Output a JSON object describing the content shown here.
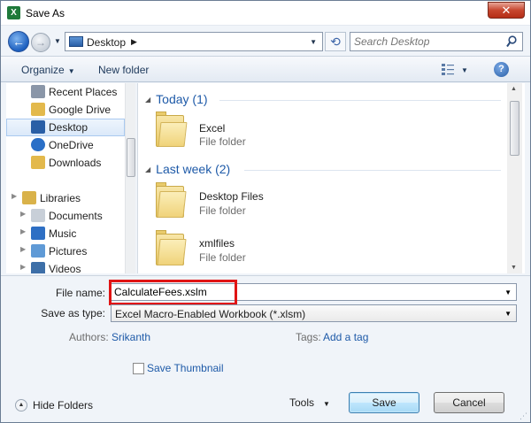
{
  "window": {
    "title": "Save As",
    "app_icon_letter": "X",
    "close_symbol": "✕"
  },
  "navigation": {
    "back_symbol": "←",
    "forward_symbol": "→",
    "address_text": "Desktop",
    "address_separator": "▶",
    "refresh_symbol": "⟲",
    "search_placeholder": "Search Desktop"
  },
  "toolbar": {
    "organize_label": "Organize",
    "new_folder_label": "New folder",
    "help_symbol": "?"
  },
  "sidebar": {
    "items": [
      {
        "label": "Recent Places",
        "icon": "recent-places-icon",
        "color": "#8a96a8"
      },
      {
        "label": "Google Drive",
        "icon": "google-drive-folder-icon",
        "color": "#e3b94c"
      },
      {
        "label": "Desktop",
        "icon": "desktop-icon",
        "color": "#2a5fa6"
      },
      {
        "label": "OneDrive",
        "icon": "onedrive-icon",
        "color": "#2a6fc7"
      },
      {
        "label": "Downloads",
        "icon": "downloads-icon",
        "color": "#e3b94c"
      },
      {
        "label": "Libraries",
        "icon": "libraries-icon",
        "color": "#d9b24a"
      },
      {
        "label": "Documents",
        "icon": "documents-icon",
        "color": "#c8cfd8"
      },
      {
        "label": "Music",
        "icon": "music-icon",
        "color": "#2e6fc4"
      },
      {
        "label": "Pictures",
        "icon": "pictures-icon",
        "color": "#5f9ad6"
      },
      {
        "label": "Videos",
        "icon": "videos-icon",
        "color": "#3d6fa8"
      }
    ]
  },
  "content": {
    "groups": [
      {
        "header": "Today (1)"
      },
      {
        "header": "Last week (2)"
      }
    ],
    "items": [
      {
        "name": "Excel",
        "type": "File folder"
      },
      {
        "name": "Desktop Files",
        "type": "File folder"
      },
      {
        "name": "xmlfiles",
        "type": "File folder"
      }
    ]
  },
  "form": {
    "file_name_label": "File name:",
    "file_name_value": "CalculateFees.xslm",
    "save_as_type_label": "Save as type:",
    "save_as_type_value": "Excel Macro-Enabled Workbook (*.xlsm)",
    "authors_label": "Authors:",
    "authors_value": "Srikanth",
    "tags_label": "Tags:",
    "tags_value": "Add a tag",
    "thumbnail_label": "Save Thumbnail",
    "thumbnail_checked": false
  },
  "footer": {
    "hide_folders_label": "Hide Folders",
    "tools_label": "Tools",
    "save_label": "Save",
    "cancel_label": "Cancel"
  },
  "colors": {
    "accent_link": "#1e5aa8",
    "highlight_box": "#e01414",
    "window_bg": "#f0f4f9"
  }
}
